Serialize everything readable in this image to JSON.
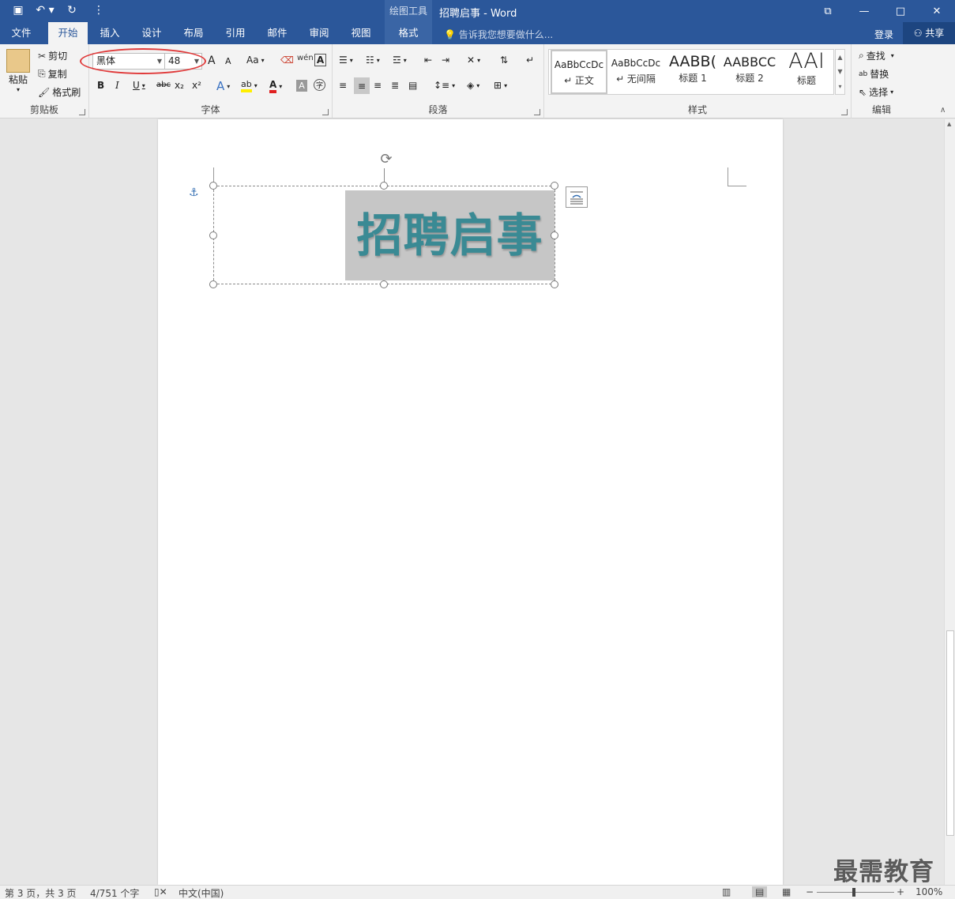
{
  "titlebar": {
    "qat": [
      {
        "name": "save-icon",
        "glyph": "▣"
      },
      {
        "name": "undo-icon",
        "glyph": "↶ ▾"
      },
      {
        "name": "redo-icon",
        "glyph": "↻"
      },
      {
        "name": "customize-qat-icon",
        "glyph": "⋮"
      }
    ],
    "context_tools": "绘图工具",
    "doc_title": "招聘启事 - Word",
    "controls": [
      "⧉",
      "—",
      "□",
      "✕"
    ]
  },
  "tabs": {
    "items": [
      "文件",
      "开始",
      "插入",
      "设计",
      "布局",
      "引用",
      "邮件",
      "审阅",
      "视图"
    ],
    "context_tab": "格式",
    "active": "开始",
    "tellme": "告诉我您想要做什么...",
    "login": "登录",
    "share": "共享"
  },
  "ribbon": {
    "clipboard": {
      "paste": "粘贴",
      "cut": "剪切",
      "copy": "复制",
      "format_painter": "格式刷",
      "label": "剪贴板"
    },
    "font": {
      "font_name": "黑体",
      "font_size": "48",
      "label": "字体",
      "grow": "A",
      "shrink": "A",
      "change_case": "Aa",
      "bold": "B",
      "italic": "I",
      "underline": "U",
      "strike": "abc",
      "subscript": "x₂",
      "superscript": "x²"
    },
    "paragraph": {
      "label": "段落"
    },
    "styles": {
      "label": "样式",
      "items": [
        {
          "preview": "AaBbCcDc",
          "name": "↵ 正文"
        },
        {
          "preview": "AaBbCcDc",
          "name": "↵ 无间隔"
        },
        {
          "preview": "AABB(",
          "name": "标题 1"
        },
        {
          "preview": "AABBCC",
          "name": "标题 2"
        },
        {
          "preview": "AAI",
          "name": "标题"
        }
      ]
    },
    "editing": {
      "find": "查找",
      "replace": "替换",
      "select": "选择",
      "label": "编辑"
    }
  },
  "document": {
    "textbox_text": "招聘启事"
  },
  "statusbar": {
    "page": "第 3 页，共 3 页",
    "words": "4/751 个字",
    "language": "中文(中国)",
    "zoom": "100%"
  },
  "watermark": "最需教育",
  "colors": {
    "brand": "#2b579a",
    "text_fill": "#3a8a94",
    "selection": "#c6c6c6",
    "annotation": "#e03b3b"
  }
}
